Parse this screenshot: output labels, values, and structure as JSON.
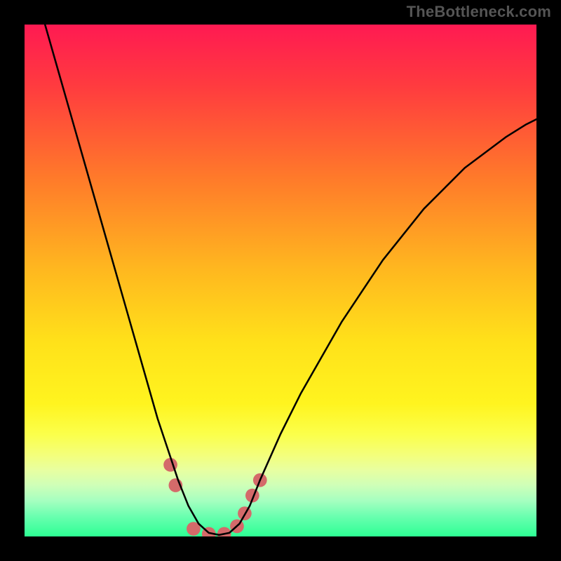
{
  "watermark": "TheBottleneck.com",
  "chart_data": {
    "type": "line",
    "title": "",
    "xlabel": "",
    "ylabel": "",
    "xlim": [
      0,
      100
    ],
    "ylim": [
      0,
      100
    ],
    "grid": false,
    "legend": false,
    "gradient_stops": [
      {
        "pct": 0,
        "color": "#ff1a52"
      },
      {
        "pct": 12,
        "color": "#ff3b3f"
      },
      {
        "pct": 30,
        "color": "#ff7a2a"
      },
      {
        "pct": 48,
        "color": "#ffb81f"
      },
      {
        "pct": 62,
        "color": "#ffe11a"
      },
      {
        "pct": 74,
        "color": "#fff41f"
      },
      {
        "pct": 80,
        "color": "#fbff4a"
      },
      {
        "pct": 84,
        "color": "#f4ff7a"
      },
      {
        "pct": 87,
        "color": "#e8ffa0"
      },
      {
        "pct": 90,
        "color": "#cfffb8"
      },
      {
        "pct": 93,
        "color": "#a6ffc0"
      },
      {
        "pct": 96,
        "color": "#6bffb0"
      },
      {
        "pct": 100,
        "color": "#2dff94"
      }
    ],
    "series": [
      {
        "name": "bottleneck-curve",
        "x": [
          4,
          6,
          8,
          10,
          12,
          14,
          16,
          18,
          20,
          22,
          24,
          26,
          28,
          30,
          32,
          34,
          36,
          38,
          40,
          42,
          44,
          46,
          50,
          54,
          58,
          62,
          66,
          70,
          74,
          78,
          82,
          86,
          90,
          94,
          98,
          100
        ],
        "y": [
          100,
          93,
          86,
          79,
          72,
          65,
          58,
          51,
          44,
          37,
          30,
          23,
          17,
          11,
          6,
          2.5,
          0.7,
          0.3,
          0.7,
          2.5,
          6,
          11,
          20,
          28,
          35,
          42,
          48,
          54,
          59,
          64,
          68,
          72,
          75,
          78,
          80.5,
          81.5
        ]
      }
    ],
    "markers": {
      "name": "highlighted-points",
      "color": "#d46a6a",
      "points": [
        {
          "x": 28.5,
          "y": 14
        },
        {
          "x": 29.5,
          "y": 10
        },
        {
          "x": 33,
          "y": 1.5
        },
        {
          "x": 36,
          "y": 0.5
        },
        {
          "x": 39,
          "y": 0.5
        },
        {
          "x": 41.5,
          "y": 2
        },
        {
          "x": 43,
          "y": 4.5
        },
        {
          "x": 44.5,
          "y": 8
        },
        {
          "x": 46,
          "y": 11
        }
      ]
    }
  }
}
